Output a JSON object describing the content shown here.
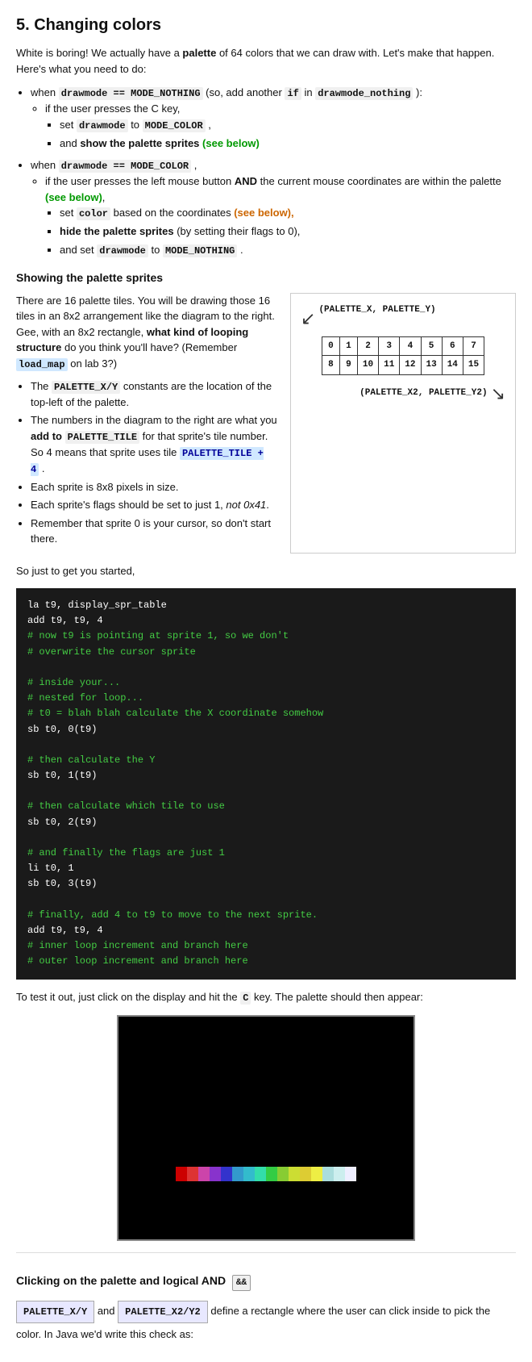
{
  "page": {
    "title": "5. Changing colors",
    "intro": "White is boring! We actually have a palette of 64 colors that we can draw with. Let's make that happen. Here's what you need to do:",
    "section1_heading": "Showing the palette sprites",
    "section1_para1": "There are 16 palette tiles. You will be drawing those 16 tiles in an 8x2 arrangement like the diagram to the right. Gee, with an 8x2 rectangle, what kind of looping structure do you think you'll have? (Remember load_map on lab 3?)",
    "bullet_items": [
      {
        "text_before": "when ",
        "code1": "drawmode == MODE_NOTHING",
        "text_mid": " (so, add another ",
        "code2": "if",
        "text_mid2": " in ",
        "code3": "drawmode_nothing",
        "text_after": " ):",
        "sub": [
          {
            "text": "if the user presses the C key,",
            "sub2": [
              {
                "text_before": "set ",
                "code": "drawmode",
                "text_mid": " to ",
                "code2": "MODE_COLOR",
                "text_after": " ,"
              },
              {
                "text_before": "and ",
                "bold": "show the palette sprites",
                "green": " (see below)"
              }
            ]
          }
        ]
      },
      {
        "text_before": "when ",
        "code1": "drawmode == MODE_COLOR",
        "text_after": " ,",
        "sub": [
          {
            "text_before": "if the user presses the left mouse button ",
            "bold": "AND",
            "text_mid": " the current mouse coordinates are within the palette ",
            "green": "(see below)",
            "text_after": ",",
            "sub2": [
              {
                "text_before": "set ",
                "bold_code": "color",
                "text_mid": " based on the coordinates ",
                "orange": "(see below),"
              },
              {
                "bold": "hide the palette sprites",
                "text_after": " (by setting their flags to 0),"
              },
              {
                "text_before": "and set ",
                "bold_code2": "drawmode",
                "text_mid": " to ",
                "bold_code3": "MODE_NOTHING",
                "text_after": " ."
              }
            ]
          }
        ]
      }
    ],
    "palette_diagram": {
      "top_label": "(PALETTE_X, PALETTE_Y)",
      "row1": [
        "0",
        "1",
        "2",
        "3",
        "4",
        "5",
        "6",
        "7"
      ],
      "row2": [
        "8",
        "9",
        "10",
        "11",
        "12",
        "13",
        "14",
        "15"
      ],
      "bottom_label": "(PALETTE_X2, PALETTE_Y2)"
    },
    "bullets2": [
      {
        "text_before": "The ",
        "code": "PALETTE_X/Y",
        "text_after": " constants are the location of the top-left of the palette."
      },
      {
        "text_before": "The numbers in the diagram to the right are what you ",
        "bold": "add to",
        "code": " PALETTE_TILE",
        "text_after": " for that sprite's tile number. So 4 means that sprite uses tile ",
        "code2": "PALETTE_TILE + 4",
        "text_after2": " ."
      },
      {
        "text": "Each sprite is 8x8 pixels in size."
      },
      {
        "text_before": "Each sprite's flags should be set to just 1, ",
        "italic": "not 0x41",
        "text_after": "."
      },
      {
        "text": "Remember that sprite 0 is your cursor, so don't start there."
      }
    ],
    "so_text": "So just to get you started,",
    "code_block": [
      {
        "line": "la t9, display_spr_table",
        "color": "white"
      },
      {
        "line": "add t9, t9, 4",
        "color": "white"
      },
      {
        "line": "# now t9 is pointing at sprite 1, so we don't",
        "color": "green"
      },
      {
        "line": "# overwrite the cursor sprite",
        "color": "green"
      },
      {
        "line": "",
        "color": "white"
      },
      {
        "line": "# inside your...",
        "color": "green"
      },
      {
        "line": "    # nested for loop...",
        "color": "green"
      },
      {
        "line": "        # t0 = blah blah calculate the X coordinate somehow",
        "color": "green"
      },
      {
        "line": "        sb t0, 0(t9)",
        "color": "white"
      },
      {
        "line": "",
        "color": "white"
      },
      {
        "line": "        # then calculate the Y",
        "color": "green"
      },
      {
        "line": "        sb t0, 1(t9)",
        "color": "white"
      },
      {
        "line": "",
        "color": "white"
      },
      {
        "line": "        # then calculate which tile to use",
        "color": "green"
      },
      {
        "line": "        sb t0, 2(t9)",
        "color": "white"
      },
      {
        "line": "",
        "color": "white"
      },
      {
        "line": "        # and finally the flags are just 1",
        "color": "green"
      },
      {
        "line": "        li t0, 1",
        "color": "white"
      },
      {
        "line": "        sb t0, 3(t9)",
        "color": "white"
      },
      {
        "line": "",
        "color": "white"
      },
      {
        "line": "        # finally, add 4 to t9 to move to the next sprite.",
        "color": "green"
      },
      {
        "line": "        add t9, t9, 4",
        "color": "white"
      },
      {
        "line": "    # inner loop increment and branch here",
        "color": "green"
      },
      {
        "line": "# outer loop increment and branch here",
        "color": "green"
      }
    ],
    "test_text_before": "To test it out, just click on the display and hit the ",
    "test_key": "C",
    "test_text_after": " key. The palette should then appear:",
    "bottom_heading": "Clicking on the palette and logical AND  &&",
    "bottom_para": " PALETTE_X/Y  and  PALETTE_X2/Y2  define a rectangle where the user can click inside to pick the color. In Java we'd write this check as:"
  }
}
